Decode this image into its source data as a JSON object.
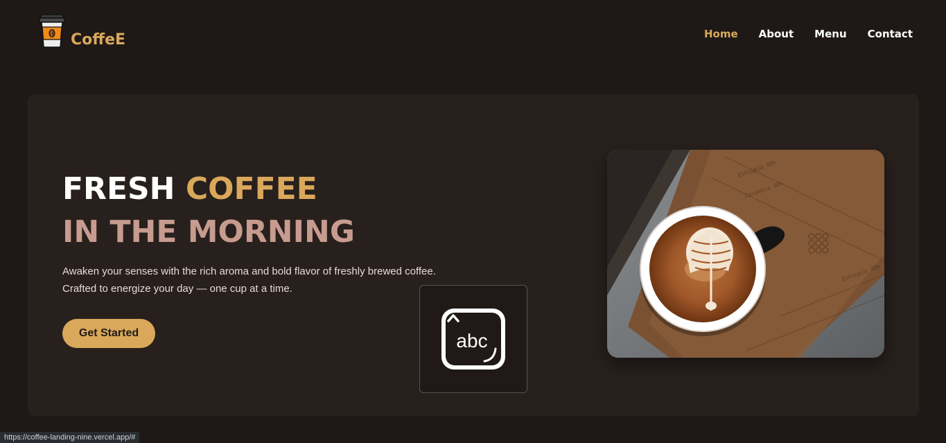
{
  "brand": {
    "name": "CoffeE",
    "icon": "coffee-cup-icon",
    "accent": "#d9a85a"
  },
  "nav": {
    "items": [
      {
        "label": "Home",
        "active": true
      },
      {
        "label": "About",
        "active": false
      },
      {
        "label": "Menu",
        "active": false
      },
      {
        "label": "Contact",
        "active": false
      }
    ]
  },
  "hero": {
    "headline_word1": "FRESH",
    "headline_word2": "COFFEE",
    "headline_line2": "IN THE MORNING",
    "description_line1": "Awaken your senses with the rich aroma and bold flavor of freshly brewed coffee.",
    "description_line2": "Crafted to energize your day — one cup at a time.",
    "cta_label": "Get Started",
    "image": "latte-art-cup-on-wooden-board"
  },
  "ime_overlay": {
    "icon": "ime-keyboard-icon",
    "text": "abc"
  },
  "status_bar": {
    "url": "https://coffee-landing-nine.vercel.app/#"
  },
  "colors": {
    "background": "#1e1917",
    "card": "#28201d",
    "gold": "#d9a85a",
    "pink": "#c79b8f"
  }
}
